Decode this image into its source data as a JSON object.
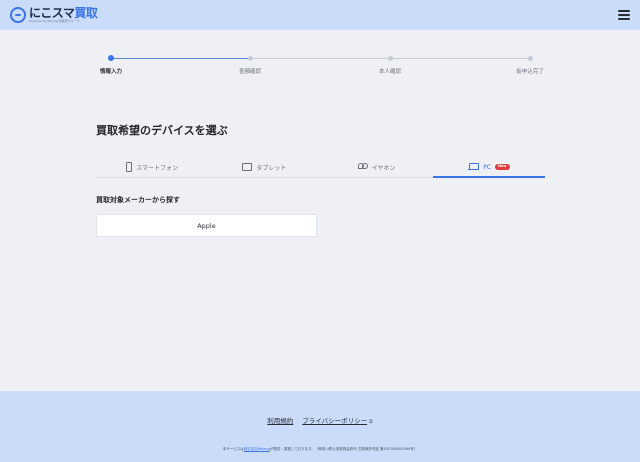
{
  "header": {
    "logo_main_a": "にこスマ",
    "logo_main_b": "買取",
    "logo_sub": "Powered by Belong  伊藤忠グループ",
    "menu_icon": "hamburger-menu-icon"
  },
  "stepper": {
    "steps": [
      {
        "label": "情報入力",
        "state": "current"
      },
      {
        "label": "査額確認",
        "state": "pending"
      },
      {
        "label": "本人確認",
        "state": "pending"
      },
      {
        "label": "仮申込完了",
        "state": "pending"
      }
    ]
  },
  "device_section": {
    "title": "買取希望のデバイスを選ぶ",
    "tabs": [
      {
        "label": "スマートフォン",
        "icon": "smartphone-icon",
        "selected": false
      },
      {
        "label": "タブレット",
        "icon": "tablet-icon",
        "selected": false
      },
      {
        "label": "イヤホン",
        "icon": "earphone-icon",
        "selected": false
      },
      {
        "label": "PC",
        "icon": "laptop-icon",
        "selected": true,
        "badge": "New"
      }
    ]
  },
  "maker_section": {
    "title": "買取対象メーカーから探す",
    "makers": [
      "Apple"
    ]
  },
  "footer": {
    "terms_label": "利用規約",
    "privacy_label": "プライバシーポリシー",
    "note_prefix": "本サービスは",
    "note_company": "株式会社Belong",
    "note_suffix": "が提供・運営しております。（神奈川県公安委員会許可 古物商許可証 第452760004390号）"
  },
  "colors": {
    "accent": "#3b73e8",
    "header_bg": "#cadcf9",
    "page_bg": "#eff0f4",
    "badge": "#e23b3b"
  }
}
